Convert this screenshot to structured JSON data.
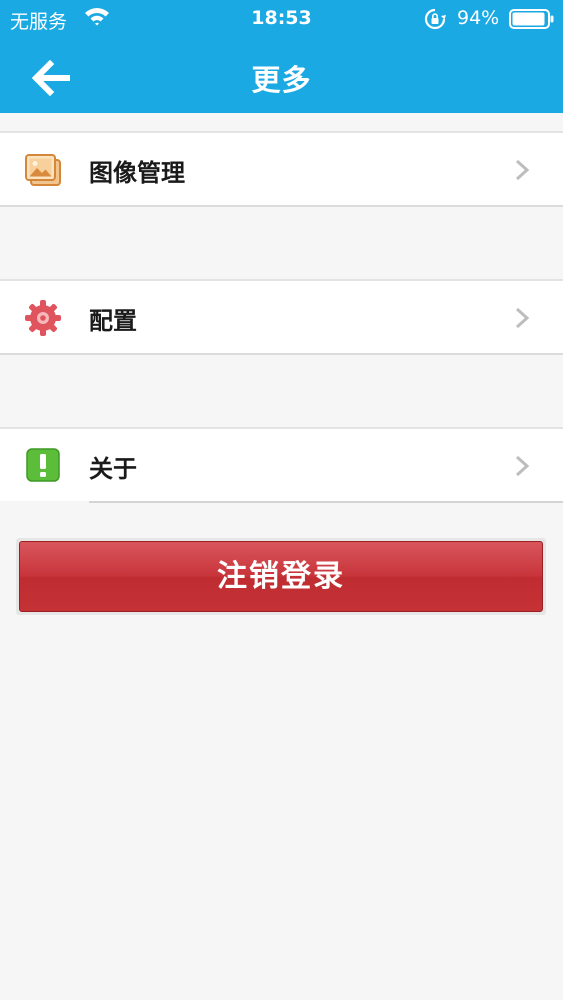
{
  "status_bar": {
    "carrier": "无服务",
    "time": "18:53",
    "battery_percent": "94%",
    "battery_level": 0.94
  },
  "nav": {
    "title": "更多",
    "back_icon": "arrow-left-icon"
  },
  "menu": [
    {
      "label": "图像管理",
      "icon": "image-gallery-icon"
    },
    {
      "label": "配置",
      "icon": "gear-icon"
    },
    {
      "label": "关于",
      "icon": "exclamation-icon"
    }
  ],
  "logout_button": {
    "label": "注销登录"
  },
  "colors": {
    "header": "#1aa9e3",
    "logout": "#c8363c",
    "background": "#f6f6f6"
  }
}
